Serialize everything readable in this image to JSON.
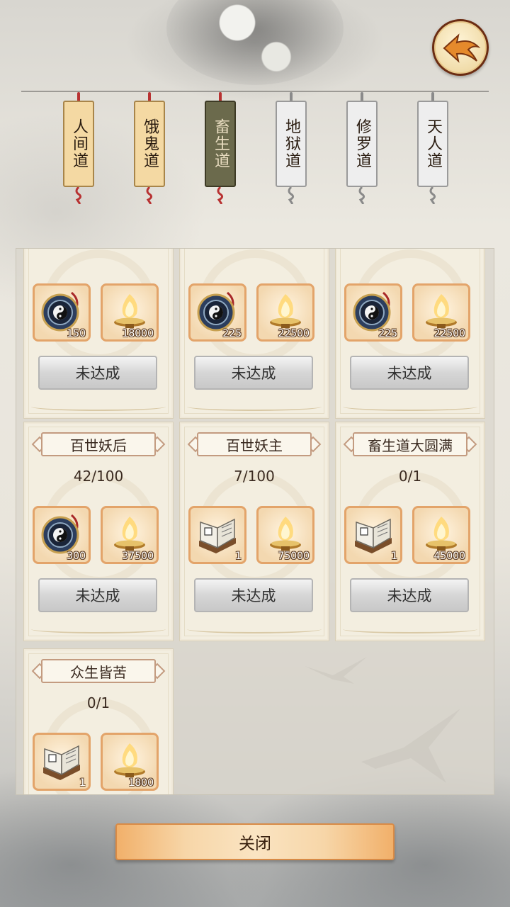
{
  "tabs": [
    {
      "label": "人间道",
      "state": "normal"
    },
    {
      "label": "饿鬼道",
      "state": "normal"
    },
    {
      "label": "畜生道",
      "state": "active"
    },
    {
      "label": "地狱道",
      "state": "locked"
    },
    {
      "label": "修罗道",
      "state": "locked"
    },
    {
      "label": "天人道",
      "state": "locked"
    }
  ],
  "cards": [
    {
      "title": "",
      "progress": "",
      "items": [
        {
          "icon": "bagua-compass-icon",
          "qty": "150"
        },
        {
          "icon": "golden-flame-censer-icon",
          "qty": "18000"
        }
      ],
      "status": "未达成"
    },
    {
      "title": "",
      "progress": "",
      "items": [
        {
          "icon": "bagua-compass-icon",
          "qty": "225"
        },
        {
          "icon": "golden-flame-censer-icon",
          "qty": "22500"
        }
      ],
      "status": "未达成"
    },
    {
      "title": "",
      "progress": "",
      "items": [
        {
          "icon": "bagua-compass-icon",
          "qty": "225"
        },
        {
          "icon": "golden-flame-censer-icon",
          "qty": "22500"
        }
      ],
      "status": "未达成"
    },
    {
      "title": "百世妖后",
      "progress": "42/100",
      "items": [
        {
          "icon": "bagua-compass-icon",
          "qty": "300"
        },
        {
          "icon": "golden-flame-censer-icon",
          "qty": "37500"
        }
      ],
      "status": "未达成"
    },
    {
      "title": "百世妖主",
      "progress": "7/100",
      "items": [
        {
          "icon": "scripture-book-icon",
          "qty": "1"
        },
        {
          "icon": "golden-flame-censer-icon",
          "qty": "75000"
        }
      ],
      "status": "未达成"
    },
    {
      "title": "畜生道大圆满",
      "progress": "0/1",
      "items": [
        {
          "icon": "scripture-book-icon",
          "qty": "1"
        },
        {
          "icon": "golden-flame-censer-icon",
          "qty": "45000"
        }
      ],
      "status": "未达成"
    },
    {
      "title": "众生皆苦",
      "progress": "0/1",
      "items": [
        {
          "icon": "scripture-book-icon",
          "qty": "1"
        },
        {
          "icon": "golden-flame-censer-icon",
          "qty": "1800"
        }
      ],
      "status": ""
    }
  ],
  "close_label": "关闭",
  "colors": {
    "accent": "#e3a46a",
    "active_tab": "#6b6a4c",
    "button_gray": "#d6d6d6"
  }
}
